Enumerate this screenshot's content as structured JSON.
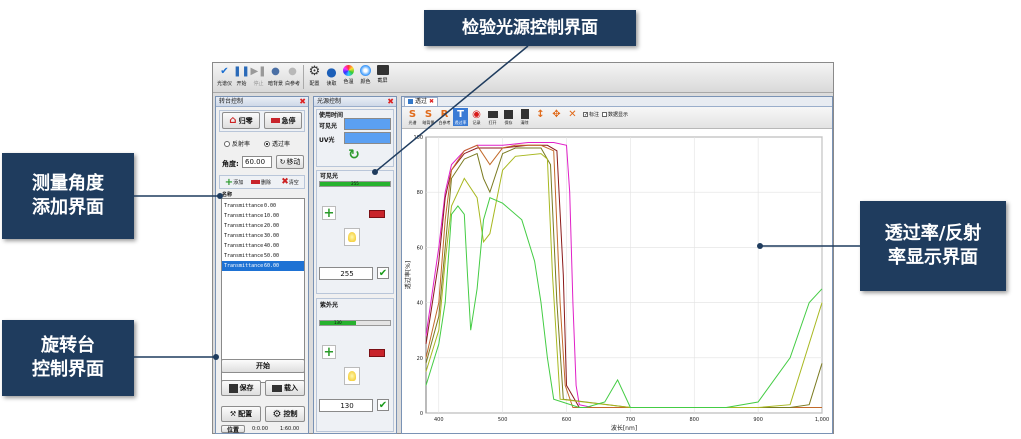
{
  "callouts": {
    "light_source": "检验光源控制界面",
    "angle_add_line1": "测量角度",
    "angle_add_line2": "添加界面",
    "transmit_display_line1": "透过率/反射",
    "transmit_display_line2": "率显示界面",
    "turntable_line1": "旋转台",
    "turntable_line2": "控制界面"
  },
  "toolbar": {
    "items": [
      "光谱仪",
      "开始",
      "停止",
      "暗背景",
      "白参考",
      "配置",
      "读取",
      "色温",
      "颜色",
      "截屏"
    ]
  },
  "turntable_panel": {
    "title": "转台控制",
    "home_label": "归零",
    "stop_label": "急停",
    "radio_reflect": "反射率",
    "radio_transmit": "透过率",
    "angle_label": "角度:",
    "angle_value": "60.00",
    "move_label": "移动",
    "add_label": "添加",
    "delete_label": "删除",
    "clear_label": "清空",
    "list_header": "名称",
    "list_rows": [
      {
        "name": "Transmittance",
        "value": "0.00"
      },
      {
        "name": "Transmittance",
        "value": "10.00"
      },
      {
        "name": "Transmittance",
        "value": "20.00"
      },
      {
        "name": "Transmittance",
        "value": "30.00"
      },
      {
        "name": "Transmittance",
        "value": "40.00"
      },
      {
        "name": "Transmittance",
        "value": "50.00"
      },
      {
        "name": "Transmittance",
        "value": "60.00"
      }
    ],
    "start_label": "开始",
    "save_label": "保存",
    "load_label": "载入",
    "config_label": "配置",
    "control_label": "控制",
    "position_label": "位置",
    "pos_a": "0:0.00",
    "pos_b": "1:60.00"
  },
  "light_panel": {
    "title": "光源控制",
    "usage_time": "使用时间",
    "visible_label": "可见光",
    "uv_label": "UV光",
    "visible_section": "可见光",
    "visible_bar_text": "255",
    "visible_bar_fraction": 1.0,
    "visible_value": "255",
    "uv_section": "紫外光",
    "uv_bar_text": "130",
    "uv_bar_fraction": 0.51,
    "uv_value": "130"
  },
  "chart_panel": {
    "tab_label": "透过",
    "tools": [
      "光谱",
      "暗背景",
      "白参考",
      "透过率",
      "记录",
      "打开",
      "保存",
      "清除"
    ],
    "chk_label_1": "标注",
    "chk_label_2": "数据显示"
  },
  "chart_data": {
    "type": "line",
    "xlabel": "波长[nm]",
    "ylabel": "透过率[%]",
    "xlim": [
      380,
      1000
    ],
    "ylim": [
      0,
      100
    ],
    "xticks": [
      "400",
      "500",
      "600",
      "700",
      "800",
      "900",
      "1,000"
    ],
    "yticks": [
      "0",
      "20",
      "40",
      "60",
      "80",
      "100"
    ],
    "grid": true,
    "series": [
      {
        "color": "#e020c8",
        "x": [
          380,
          400,
          410,
          420,
          440,
          460,
          480,
          500,
          540,
          580,
          600,
          605,
          610,
          615,
          620,
          640,
          700,
          800,
          1000
        ],
        "y": [
          28,
          60,
          80,
          90,
          95,
          97,
          97,
          97,
          98,
          98,
          97,
          80,
          40,
          10,
          3,
          2,
          2,
          2,
          2
        ]
      },
      {
        "color": "#8b1a1a",
        "x": [
          380,
          400,
          410,
          420,
          440,
          460,
          480,
          500,
          540,
          570,
          585,
          595,
          600,
          620,
          700,
          1000
        ],
        "y": [
          25,
          55,
          78,
          88,
          94,
          96,
          96,
          96,
          97,
          97,
          95,
          50,
          10,
          2,
          2,
          2
        ]
      },
      {
        "color": "#c26a2a",
        "x": [
          380,
          400,
          410,
          420,
          440,
          460,
          480,
          500,
          520,
          560,
          580,
          590,
          598,
          610,
          700,
          1000
        ],
        "y": [
          20,
          40,
          70,
          88,
          95,
          97,
          90,
          96,
          97,
          97,
          95,
          40,
          10,
          2,
          2,
          2
        ]
      },
      {
        "color": "#7a7a20",
        "x": [
          380,
          400,
          410,
          420,
          440,
          460,
          470,
          480,
          500,
          520,
          560,
          575,
          585,
          595,
          700,
          950,
          980,
          1000
        ],
        "y": [
          18,
          35,
          60,
          85,
          92,
          94,
          85,
          80,
          94,
          96,
          96,
          90,
          40,
          5,
          2,
          2,
          3,
          18
        ]
      },
      {
        "color": "#a8b820",
        "x": [
          380,
          400,
          410,
          420,
          440,
          460,
          470,
          480,
          500,
          520,
          560,
          570,
          578,
          590,
          700,
          900,
          950,
          1000
        ],
        "y": [
          15,
          30,
          55,
          75,
          85,
          78,
          62,
          65,
          88,
          93,
          94,
          92,
          50,
          5,
          2,
          2,
          3,
          40
        ]
      },
      {
        "color": "#44cc44",
        "x": [
          380,
          400,
          410,
          420,
          430,
          440,
          445,
          450,
          460,
          470,
          480,
          500,
          530,
          550,
          560,
          570,
          580,
          620,
          630,
          660,
          680,
          700,
          850,
          900,
          950,
          980,
          1000
        ],
        "y": [
          10,
          25,
          40,
          72,
          75,
          72,
          50,
          30,
          45,
          70,
          78,
          76,
          70,
          55,
          40,
          20,
          5,
          2,
          2,
          4,
          12,
          2,
          2,
          4,
          20,
          40,
          45
        ]
      }
    ]
  }
}
